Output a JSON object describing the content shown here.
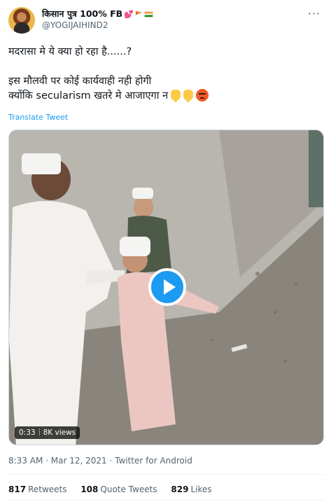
{
  "tweet": {
    "display_name": "किसान पुत्र 100% FB",
    "handle": "@YOGIJAIHIND2",
    "more_icon": "more-dots-icon",
    "text_line1": "मदरासा मे ये क्या हो रहा है......?",
    "text_line2": "इस मौलवी पर कोई कार्यवाही नही होगी",
    "text_line3": "क्योंकि secularism खतरे मे आजाएगा न",
    "emojis": [
      "backhand-index-pointing-down",
      "backhand-index-pointing-down",
      "pouting-face"
    ],
    "translate_label": "Translate Tweet",
    "video": {
      "duration": "0:33",
      "views": "8K views",
      "play_icon": "play-icon"
    },
    "timestamp": "8:33 AM · Mar 12, 2021 · Twitter for Android",
    "stats": {
      "retweets_count": "817",
      "retweets_label": "Retweets",
      "quotes_count": "108",
      "quotes_label": "Quote Tweets",
      "likes_count": "829",
      "likes_label": "Likes"
    }
  },
  "colors": {
    "accent": "#1d9bf0",
    "secondary_text": "#536471",
    "primary_text": "#0f1419"
  }
}
